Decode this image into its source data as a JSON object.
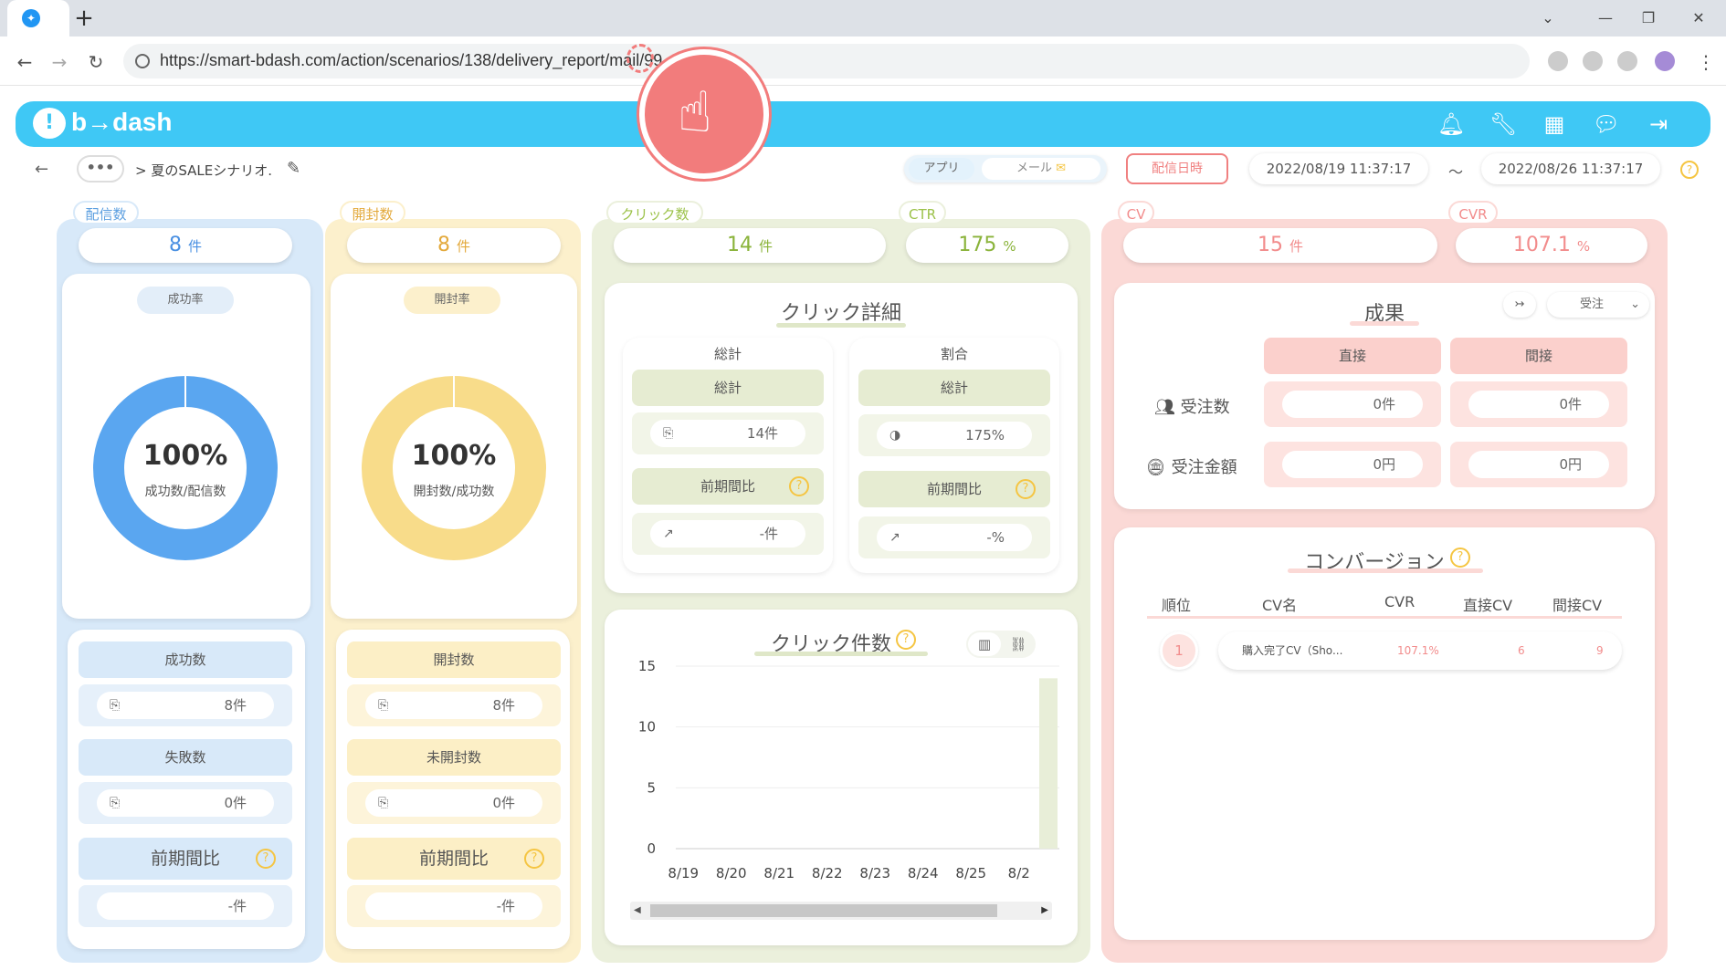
{
  "browser": {
    "url": "https://smart-bdash.com/action/scenarios/138/delivery_report/mail/99",
    "new_tab": "+"
  },
  "app": {
    "logo": "b→dash"
  },
  "subheader": {
    "breadcrumb": "> 夏のSALEシナリオ.",
    "more": "•••",
    "seg_app": "アプリ",
    "seg_mail": "メール",
    "date_button": "配信日時",
    "date_from": "2022/08/19 11:37:17",
    "tilde": "～",
    "date_to": "2022/08/26 11:37:17"
  },
  "delivery": {
    "tag": "配信数",
    "value": "8",
    "unit": "件",
    "rate_pill": "成功率",
    "donut_pct": "100%",
    "donut_label": "成功数/配信数",
    "donut_fraction": 1.0,
    "success_label": "成功数",
    "success_value": "8件",
    "fail_label": "失敗数",
    "fail_value": "0件",
    "prev_label": "前期間比",
    "prev_value": "-件"
  },
  "open": {
    "tag": "開封数",
    "value": "8",
    "unit": "件",
    "rate_pill": "開封率",
    "donut_pct": "100%",
    "donut_label": "開封数/成功数",
    "donut_fraction": 1.0,
    "open_label": "開封数",
    "open_value": "8件",
    "unopen_label": "未開封数",
    "unopen_value": "0件",
    "prev_label": "前期間比",
    "prev_value": "-件"
  },
  "click": {
    "tag": "クリック数",
    "value": "14",
    "unit": "件",
    "ctr_tag": "CTR",
    "ctr_value": "175",
    "ctr_unit": "%",
    "detail_title": "クリック詳細",
    "total_title": "総計",
    "total_head": "総計",
    "total_value": "14件",
    "total_prev_label": "前期間比",
    "total_prev_value": "-件",
    "ratio_title": "割合",
    "ratio_head": "総計",
    "ratio_value": "175%",
    "ratio_prev_label": "前期間比",
    "ratio_prev_value": "-%",
    "chart_title": "クリック件数"
  },
  "cv": {
    "tag": "CV",
    "value": "15",
    "unit": "件",
    "cvr_tag": "CVR",
    "cvr_value": "107.1",
    "cvr_unit": "%",
    "result_title": "成果",
    "order_select": "受注",
    "direct": "直接",
    "indirect": "間接",
    "orders_label": "受注数",
    "orders_direct": "0件",
    "orders_indirect": "0件",
    "amount_label": "受注金額",
    "amount_direct": "0円",
    "amount_indirect": "0円",
    "conv_title": "コンバージョン",
    "table_headers": [
      "順位",
      "CV名",
      "CVR",
      "直接CV",
      "間接CV"
    ],
    "rows": [
      {
        "rank": "1",
        "name": "購入完了CV（Sho...",
        "cvr": "107.1%",
        "direct": "6",
        "indirect": "9"
      }
    ]
  },
  "chart_data": {
    "type": "bar",
    "title": "クリック件数",
    "categories": [
      "8/19",
      "8/20",
      "8/21",
      "8/22",
      "8/23",
      "8/24",
      "8/25",
      "8/2"
    ],
    "values": [
      0,
      0,
      0,
      0,
      0,
      0,
      0,
      14
    ],
    "ylim": [
      0,
      15
    ],
    "yticks": [
      "15",
      "10",
      "5",
      "0"
    ],
    "color": "#e8eed8"
  },
  "colors": {
    "accent": "#3fc8f5",
    "delivery": "#6aaef0",
    "open": "#f8dc8a",
    "click": "#9cc24a",
    "cv": "#f28c8c"
  }
}
